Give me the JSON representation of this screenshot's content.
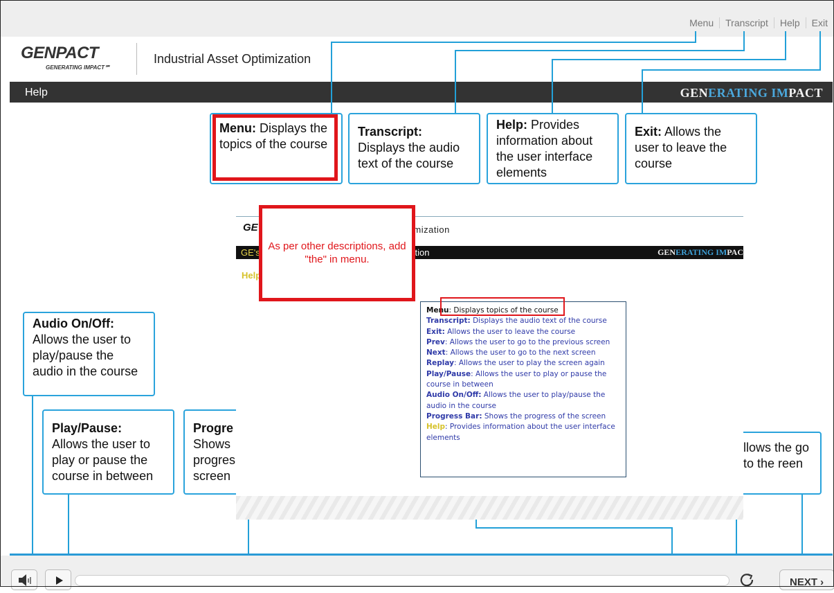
{
  "topnav": [
    "Menu",
    "Transcript",
    "Help",
    "Exit"
  ],
  "logo": {
    "main": "GENPACT",
    "tagline": "GENERATING IMPACT℠"
  },
  "course_title": "Industrial Asset Optimization",
  "darkbar": {
    "help": "Help",
    "brand_a": "GEN",
    "brand_b": "ERATING IM",
    "brand_c": "PACT"
  },
  "callouts": {
    "menu": {
      "key": "Menu:",
      "text": " Displays the topics of the course"
    },
    "transcript": {
      "key": "Transcript:",
      "text": " Displays the audio text of the course"
    },
    "help": {
      "key": "Help:",
      "text": " Provides information about the user interface elements"
    },
    "exit": {
      "key": "Exit:",
      "text": " Allows the user to leave the course"
    },
    "audio": {
      "key": "Audio On/Off:",
      "text": " Allows the user to play/pause the audio in the course"
    },
    "playpause": {
      "key": "Play/Pause:",
      "text": " Allows the user to play or pause the course in between"
    },
    "progress": {
      "key": "Progre",
      "text": "Shows progres screen"
    },
    "next": {
      "text": "llows the go to the reen"
    }
  },
  "comment": "As per other descriptions, add \"the\" in menu.",
  "embed": {
    "logo": "GE",
    "title": "imization",
    "bar_left": "GE's",
    "bar_section": "ction",
    "brand_a": "GEN",
    "brand_b": "ERATING IM",
    "brand_c": "PAC",
    "help": "Help"
  },
  "legend": [
    {
      "key": "Menu",
      "text": ": Displays topics of the course"
    },
    {
      "key": "Transcript:",
      "text": " Displays the audio text of the course"
    },
    {
      "key": "Exit:",
      "text": " Allows the user to leave the course"
    },
    {
      "key": "Prev",
      "text": ": Allows the user to go to the previous screen"
    },
    {
      "key": "Next",
      "text": ": Allows the user to go to the next screen"
    },
    {
      "key": "Replay",
      "text": ": Allows the user to play the screen again"
    },
    {
      "key": "Play/Pause",
      "text": ": Allows the user to play or pause the course in between"
    },
    {
      "key": "Audio On/Off:",
      "text": " Allows the user to play/pause the audio in the course"
    },
    {
      "key": "Progress Bar:",
      "text": " Shows the progress of the screen"
    },
    {
      "key": "Help",
      "text": ": Provides information about the user interface elements"
    }
  ],
  "bottom": {
    "next_label": "NEXT ›"
  },
  "colors": {
    "accent": "#2aa3dc",
    "dark_bar": "#333333",
    "annotation_red": "#e0161b",
    "legend_blue": "#2f3aa8"
  }
}
